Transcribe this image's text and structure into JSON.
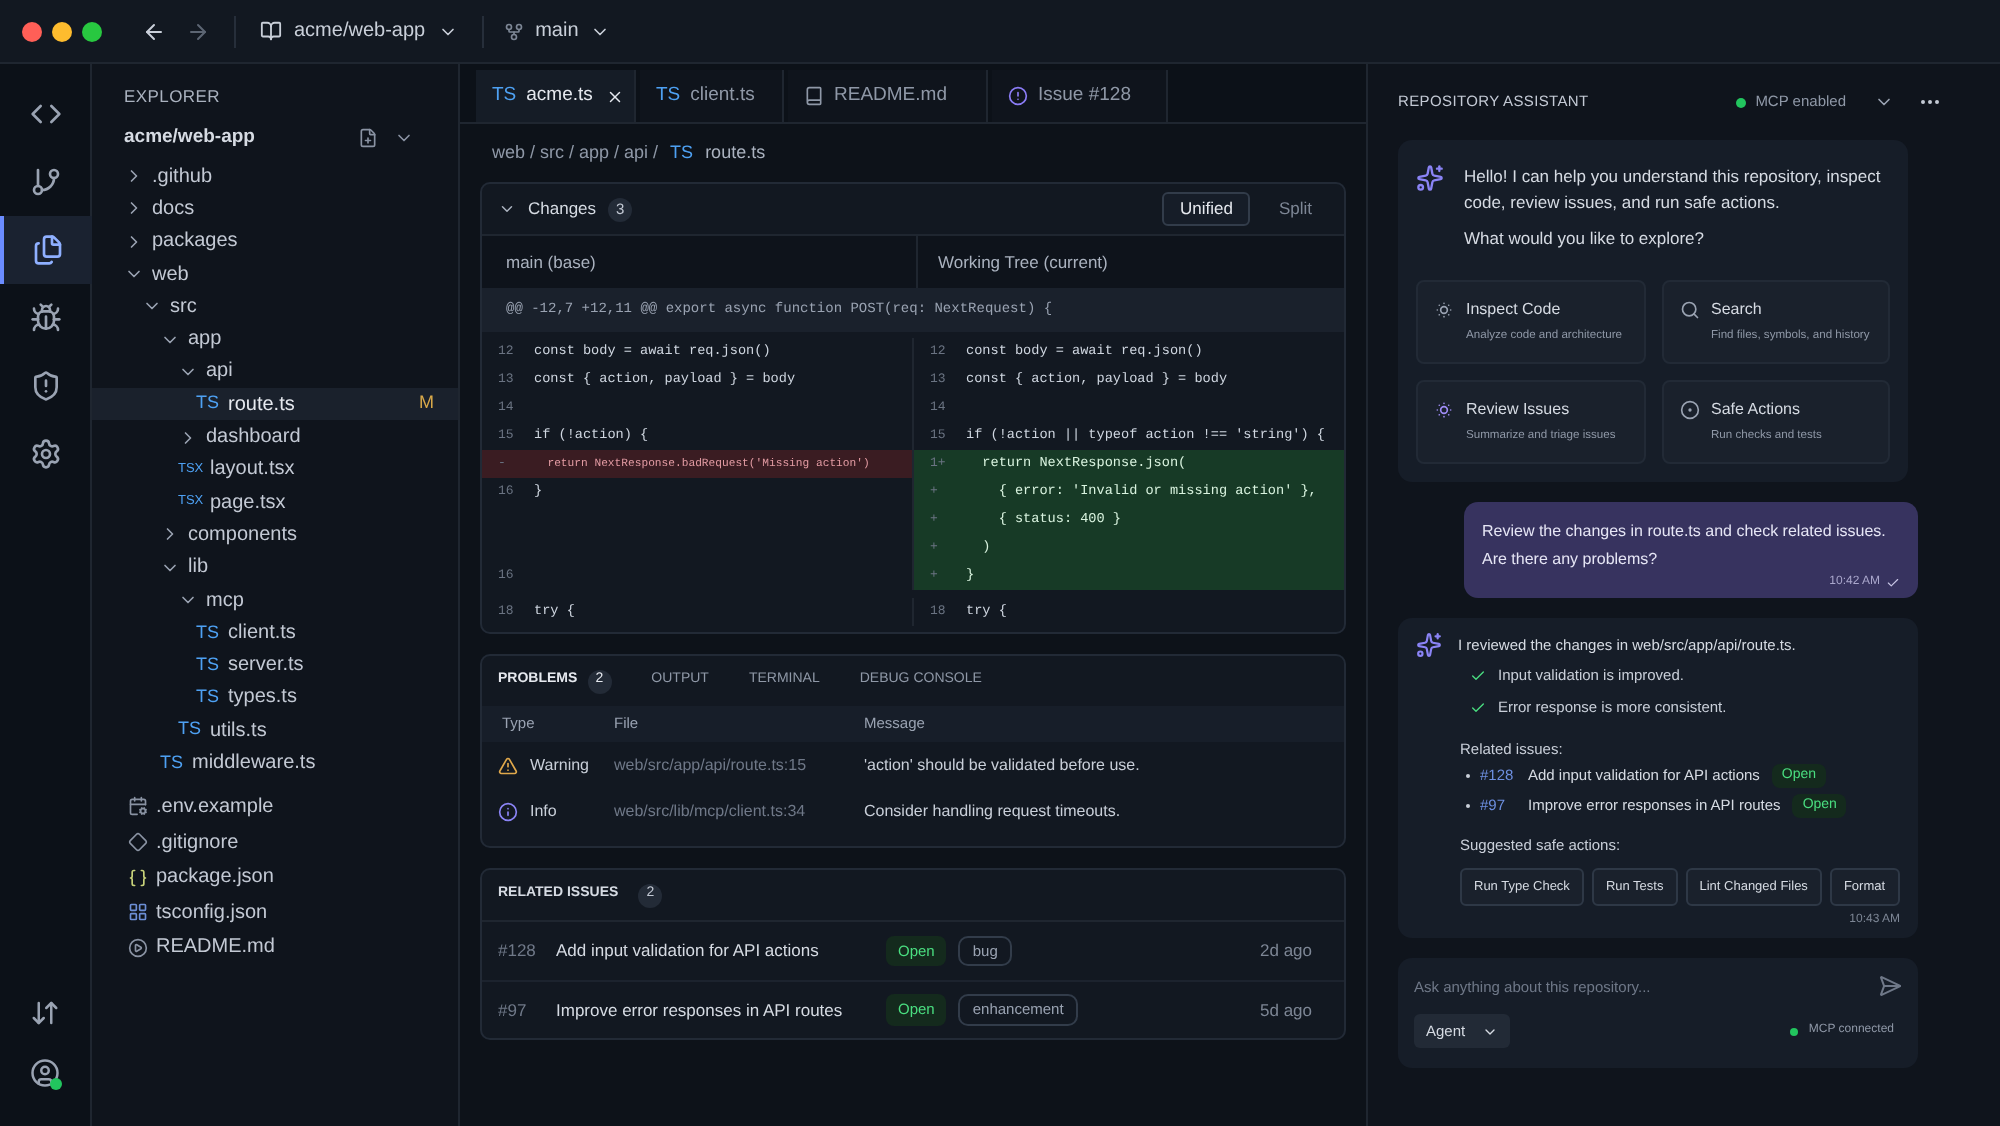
{
  "titlebar": {
    "repo": "acme/web-app",
    "branch": "main"
  },
  "activity": [
    {
      "kind": "code",
      "selected": false
    },
    {
      "kind": "branch",
      "selected": false
    },
    {
      "kind": "files",
      "selected": true
    },
    {
      "kind": "bug",
      "selected": false
    },
    {
      "kind": "shield",
      "selected": false
    },
    {
      "kind": "settings",
      "selected": false
    }
  ],
  "activity_bottom": [
    {
      "kind": "arrows"
    },
    {
      "kind": "account",
      "online": true
    }
  ],
  "explorer": {
    "title": "EXPLORER",
    "repo": "acme/web-app",
    "tree": [
      {
        "name": ".github",
        "kind": "folder",
        "expanded": false
      },
      {
        "name": "docs",
        "kind": "folder",
        "expanded": false
      },
      {
        "name": "packages",
        "kind": "folder",
        "expanded": false
      },
      {
        "name": "web",
        "kind": "folder",
        "expanded": true,
        "children": [
          {
            "name": "src",
            "kind": "folder",
            "expanded": true,
            "children": [
              {
                "name": "app",
                "kind": "folder",
                "expanded": true,
                "children": [
                  {
                    "name": "api",
                    "kind": "folder",
                    "expanded": true,
                    "children": [
                      {
                        "name": "route.ts",
                        "kind": "ts",
                        "tag": "TS",
                        "selected": true,
                        "badge": "M"
                      }
                    ]
                  },
                  {
                    "name": "dashboard",
                    "kind": "folder",
                    "expanded": false
                  },
                  {
                    "name": "layout.tsx",
                    "kind": "tsx",
                    "tag": "TSX",
                    "selected": false
                  },
                  {
                    "name": "page.tsx",
                    "kind": "tsx",
                    "tag": "TSX",
                    "selected": false
                  }
                ]
              },
              {
                "name": "components",
                "kind": "folder",
                "expanded": false
              },
              {
                "name": "lib",
                "kind": "folder",
                "expanded": true,
                "children": [
                  {
                    "name": "mcp",
                    "kind": "folder",
                    "expanded": true,
                    "children": [
                      {
                        "name": "client.ts",
                        "kind": "ts",
                        "tag": "TS",
                        "selected": false
                      },
                      {
                        "name": "server.ts",
                        "kind": "ts",
                        "tag": "TS",
                        "selected": false
                      },
                      {
                        "name": "types.ts",
                        "kind": "ts",
                        "tag": "TS",
                        "selected": false
                      }
                    ]
                  },
                  {
                    "name": "utils.ts",
                    "kind": "ts",
                    "tag": "TS",
                    "selected": false
                  }
                ]
              },
              {
                "name": "middleware.ts",
                "kind": "ts",
                "tag": "TS",
                "selected": false
              }
            ]
          }
        ]
      }
    ],
    "root_files": [
      {
        "name": ".env.example",
        "kind": "env"
      },
      {
        "name": ".gitignore",
        "kind": "git"
      },
      {
        "name": "package.json",
        "kind": "json"
      },
      {
        "name": "tsconfig.json",
        "kind": "config"
      },
      {
        "name": "README.md",
        "kind": "md"
      }
    ]
  },
  "tabs": [
    {
      "label": "acme.ts",
      "kind": "ts",
      "tag": "TS",
      "selected": true,
      "closable": true
    },
    {
      "label": "client.ts",
      "kind": "ts",
      "tag": "TS",
      "selected": false,
      "closable": false
    },
    {
      "label": "README.md",
      "kind": "md",
      "selected": false,
      "closable": false
    },
    {
      "label": "Issue #128",
      "kind": "issue",
      "selected": false,
      "closable": false
    }
  ],
  "breadcrumb": {
    "path": "web / src / app / api /",
    "tag": "TS",
    "file": "route.ts"
  },
  "changes": {
    "title": "Changes",
    "count": "3",
    "expanded": true,
    "views": [
      {
        "label": "Unified",
        "selected": true
      },
      {
        "label": "Split",
        "selected": false
      }
    ],
    "left_title": "main (base)",
    "right_title": "Working Tree (current)",
    "hunk": "@@ -12,7 +12,11 @@ export async function POST(req: NextRequest) {",
    "rows": [
      {
        "left": {
          "num": "12",
          "code": "const body = await req.json()",
          "kind": "context"
        },
        "right": {
          "num": "12",
          "code": "const body = await req.json()",
          "kind": "context"
        }
      },
      {
        "left": {
          "num": "13",
          "code": "const { action, payload } = body",
          "kind": "context"
        },
        "right": {
          "num": "13",
          "code": "const { action, payload } = body",
          "kind": "context"
        }
      },
      {
        "left": {
          "num": "14",
          "kind": "context"
        },
        "right": {
          "num": "14",
          "kind": "context"
        }
      },
      {
        "left": {
          "num": "15",
          "code": "if (!action) {",
          "kind": "context"
        },
        "right": {
          "num": "15",
          "code": "if (!action || typeof action !== 'string') {",
          "kind": "context"
        }
      },
      {
        "left": {
          "num": "-",
          "code": "  return NextResponse.badRequest('Missing action')",
          "kind": "removed"
        },
        "right": {
          "num": "1+",
          "code": "  return NextResponse.json(",
          "kind": "added"
        }
      },
      {
        "left": {
          "num": "16",
          "code": "}",
          "kind": "context"
        },
        "right": {
          "num": "+",
          "code": "    { error: 'Invalid or missing action' },",
          "kind": "added"
        }
      },
      {
        "left": {
          "kind": "empty"
        },
        "right": {
          "num": "+",
          "code": "    { status: 400 }",
          "kind": "added"
        }
      },
      {
        "left": {
          "kind": "empty"
        },
        "right": {
          "num": "+",
          "code": "  )",
          "kind": "added"
        }
      },
      {
        "left": {
          "num": "16",
          "kind": "context"
        },
        "right": {
          "num": "+",
          "code": "}",
          "kind": "added"
        }
      },
      {
        "left": {
          "num": "18",
          "code": "try {",
          "kind": "context"
        },
        "right": {
          "num": "18",
          "code": "try {",
          "kind": "context"
        }
      }
    ]
  },
  "problems": {
    "tabs": [
      {
        "label": "PROBLEMS",
        "count": "2",
        "selected": true
      },
      {
        "label": "OUTPUT",
        "selected": false
      },
      {
        "label": "TERMINAL",
        "selected": false
      },
      {
        "label": "DEBUG CONSOLE",
        "selected": false
      }
    ],
    "columns": [
      "Type",
      "File",
      "Message"
    ],
    "rows": [
      {
        "kind": "warning",
        "type": "Warning",
        "file": "web/src/app/api/route.ts:15",
        "message": "'action' should be validated before use."
      },
      {
        "kind": "info",
        "type": "Info",
        "file": "web/src/lib/mcp/client.ts:34",
        "message": "Consider handling request timeouts."
      }
    ]
  },
  "related_issues": {
    "title": "RELATED ISSUES",
    "count": "2",
    "rows": [
      {
        "number": "#128",
        "title": "Add input validation for API actions",
        "status": "Open",
        "label": "bug",
        "age": "2d ago"
      },
      {
        "number": "#97",
        "title": "Improve error responses in API routes",
        "status": "Open",
        "label": "enhancement",
        "age": "5d ago"
      }
    ]
  },
  "assistant": {
    "title": "REPOSITORY ASSISTANT",
    "status": "MCP enabled",
    "greeting": [
      "Hello! I can help you understand this repository, inspect code, review issues, and run safe actions.",
      "What would you like to explore?"
    ],
    "quick_actions": [
      {
        "kind": "inspect",
        "title": "Inspect Code",
        "desc": "Analyze code and architecture"
      },
      {
        "kind": "search",
        "title": "Search",
        "desc": "Find files, symbols, and history"
      },
      {
        "kind": "review",
        "title": "Review Issues",
        "desc": "Summarize and triage issues"
      },
      {
        "kind": "actions",
        "title": "Safe Actions",
        "desc": "Run checks and tests"
      }
    ],
    "user_message": {
      "lines": [
        "Review the changes in route.ts and check related issues.",
        "Are there any problems?"
      ],
      "time": "10:42 AM",
      "read": true
    },
    "reply": {
      "intro": "I reviewed the changes in web/src/app/api/route.ts.",
      "checks": [
        "Input validation is improved.",
        "Error response is more consistent."
      ],
      "issues_label": "Related issues:",
      "issues": [
        {
          "number": "#128",
          "title": "Add input validation for API actions",
          "status": "Open"
        },
        {
          "number": "#97",
          "title": "Improve error responses in API routes",
          "status": "Open"
        }
      ],
      "actions_label": "Suggested safe actions:",
      "actions": [
        "Run Type Check",
        "Run Tests",
        "Lint Changed Files",
        "Format"
      ],
      "time": "10:43 AM"
    },
    "composer": {
      "placeholder": "Ask anything about this repository...",
      "mode": "Agent",
      "status": "MCP connected"
    }
  }
}
